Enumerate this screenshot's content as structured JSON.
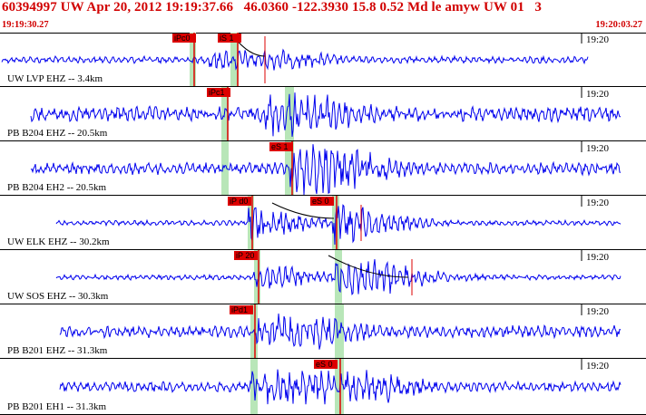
{
  "header": {
    "title": "60394997 UW Apr 20, 2012 19:19:37.66   46.0360 -122.3930 15.8 0.52 Md le amyw UW 01   3",
    "start_time": "19:19:30.27",
    "end_time": "19:20:03.27"
  },
  "colors": {
    "trace": "#0000ee",
    "pick": "#dd0000",
    "label_bg": "#dd0000",
    "window": "#b8e6b8",
    "grid": "#000000"
  },
  "traces": [
    {
      "label": "UW LVP EHZ -- 3.4km",
      "time_label": "19:20",
      "picks": [
        {
          "label": "iPc0"
        },
        {
          "label": "iS 1"
        }
      ]
    },
    {
      "label": "PB B204 EHZ -- 20.5km",
      "time_label": "19:20",
      "picks": [
        {
          "label": "iPc1"
        }
      ]
    },
    {
      "label": "PB B204 EH2 -- 20.5km",
      "time_label": "19:20",
      "picks": [
        {
          "label": "eS 1"
        }
      ]
    },
    {
      "label": "UW ELK EHZ -- 30.2km",
      "time_label": "19:20",
      "picks": [
        {
          "label": "iP d0"
        },
        {
          "label": "eS 0"
        }
      ]
    },
    {
      "label": "UW SOS EHZ -- 30.3km",
      "time_label": "19:20",
      "picks": [
        {
          "label": "iP 20"
        }
      ]
    },
    {
      "label": "PB B201 EHZ -- 31.3km",
      "time_label": "19:20",
      "picks": [
        {
          "label": "iPd1"
        }
      ]
    },
    {
      "label": "PB B201 EH1 -- 31.3km",
      "time_label": "19:20",
      "picks": [
        {
          "label": "eS 0"
        }
      ]
    }
  ]
}
